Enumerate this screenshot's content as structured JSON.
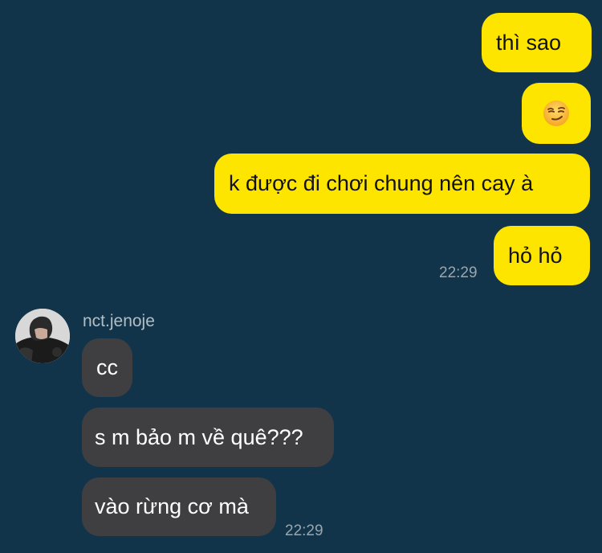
{
  "colors": {
    "background": "#12344a",
    "outgoing_bubble": "#fee500",
    "incoming_bubble": "#3f3f41",
    "timestamp": "#9aa6ad"
  },
  "messages_out": [
    {
      "text": "thì sao"
    },
    {
      "emoji": "smirking-face"
    },
    {
      "text": "k được đi chơi chung nên cay à"
    },
    {
      "text": "hỏ hỏ"
    }
  ],
  "out_timestamp": "22:29",
  "sender": {
    "name": "nct.jenoje",
    "avatar_icon": "profile-photo"
  },
  "messages_in": [
    {
      "text": "cc"
    },
    {
      "text": "s m bảo m về quê???"
    },
    {
      "text": "vào rừng cơ mà"
    }
  ],
  "in_timestamp": "22:29"
}
